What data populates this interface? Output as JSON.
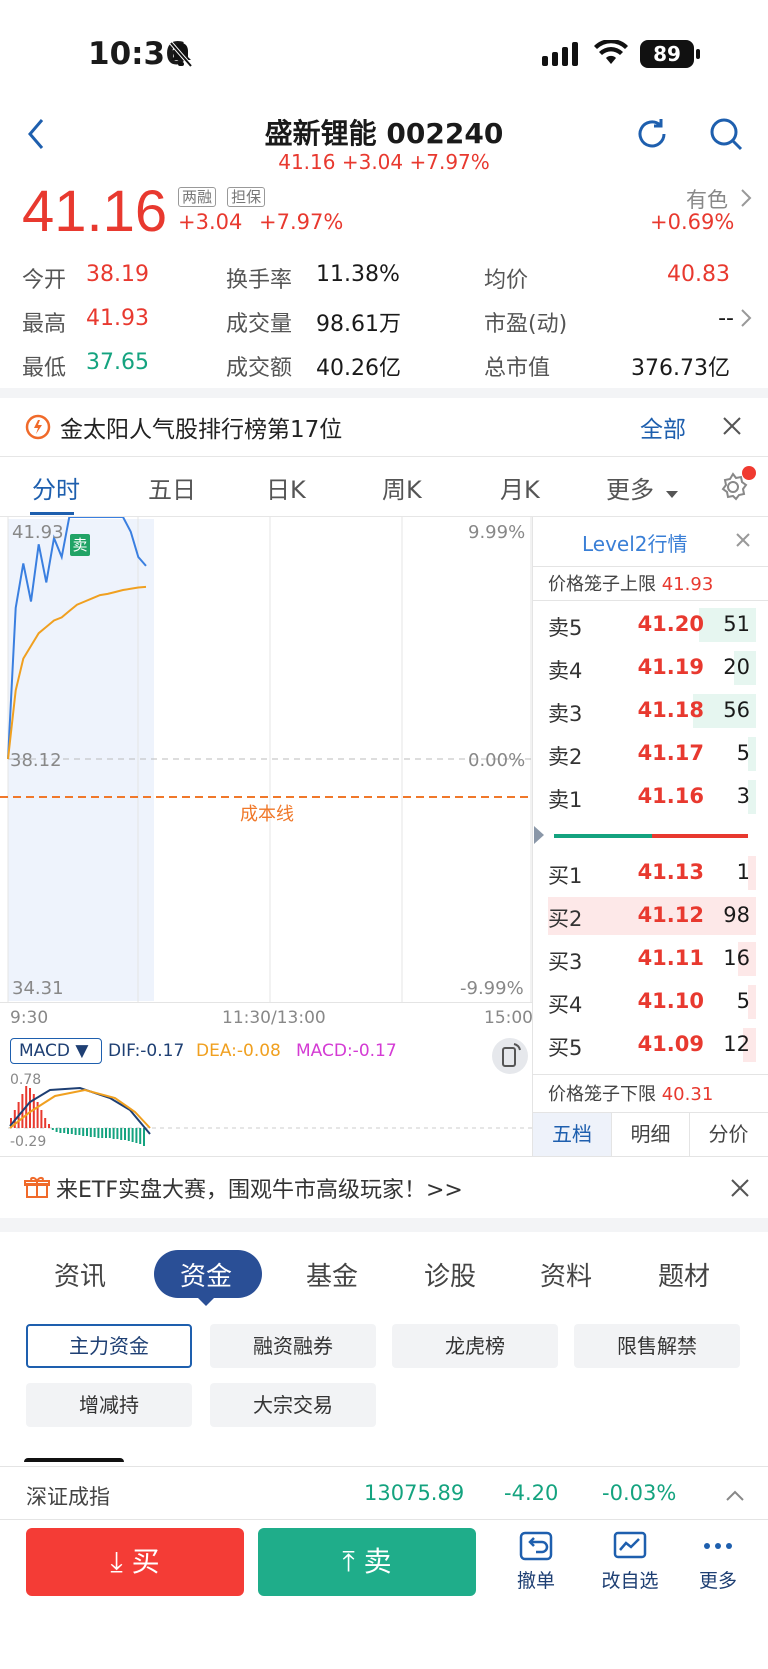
{
  "status": {
    "time": "10:36",
    "battery": "89"
  },
  "header": {
    "title": "盛新锂能 002240",
    "subtitle": "41.16 +3.04 +7.97%"
  },
  "quote": {
    "price": "41.16",
    "tag_margin": "两融",
    "tag_guarantee": "担保",
    "change": "+3.04",
    "change_pct": "+7.97%",
    "sector_name": "有色",
    "sector_change": "+0.69%"
  },
  "stats": [
    {
      "label": "今开",
      "value": "38.19",
      "color": "red"
    },
    {
      "label": "换手率",
      "value": "11.38%",
      "color": "dark"
    },
    {
      "label": "均价",
      "value": "40.83",
      "color": "red"
    },
    {
      "label": "最高",
      "value": "41.93",
      "color": "red"
    },
    {
      "label": "成交量",
      "value": "98.61万",
      "color": "dark"
    },
    {
      "label": "市盈(动)",
      "value": "--",
      "color": "dark"
    },
    {
      "label": "最低",
      "value": "37.65",
      "color": "green"
    },
    {
      "label": "成交额",
      "value": "40.26亿",
      "color": "dark"
    },
    {
      "label": "总市值",
      "value": "376.73亿",
      "color": "dark"
    }
  ],
  "ranking_banner": {
    "text": "金太阳人气股排行榜第17位",
    "action": "全部"
  },
  "chart_tabs": [
    "分时",
    "五日",
    "日K",
    "周K",
    "月K",
    "更多"
  ],
  "chart_labels": {
    "high": "41.93",
    "open": "38.12",
    "low": "34.31",
    "pct_high": "9.99%",
    "pct_mid": "0.00%",
    "pct_low": "-9.99%",
    "cost_line": "成本线",
    "sell_marker": "卖",
    "time_start": "9:30",
    "time_mid": "11:30/13:00",
    "time_end": "15:00"
  },
  "chart_data": {
    "type": "line",
    "x_range": [
      "9:30",
      "15:00"
    ],
    "ylim": [
      34.31,
      41.93
    ],
    "series": [
      {
        "values": [
          38.12,
          40.5,
          41.2,
          40.6,
          41.5,
          40.9,
          41.6,
          41.3,
          41.93,
          41.93,
          41.93,
          41.93,
          41.93,
          41.93,
          41.93,
          41.93,
          41.7,
          41.3,
          41.16
        ]
      },
      {
        "values": [
          38.12,
          39.2,
          39.7,
          39.9,
          40.1,
          40.2,
          40.3,
          40.35,
          40.45,
          40.55,
          40.6,
          40.65,
          40.7,
          40.72,
          40.75,
          40.78,
          40.8,
          40.82,
          40.83
        ]
      }
    ]
  },
  "macd": {
    "selector": "MACD",
    "dif": "DIF:-0.17",
    "dea": "DEA:-0.08",
    "macd": "MACD:-0.17",
    "top": "0.78",
    "bottom": "-0.29"
  },
  "orderbook": {
    "title": "Level2行情",
    "upper_limit_label": "价格笼子上限",
    "upper_limit": "41.93",
    "lower_limit_label": "价格笼子下限",
    "lower_limit": "40.31",
    "sells": [
      {
        "label": "卖5",
        "price": "41.20",
        "vol": "51",
        "fill": 0.52
      },
      {
        "label": "卖4",
        "price": "41.19",
        "vol": "20",
        "fill": 0.2
      },
      {
        "label": "卖3",
        "price": "41.18",
        "vol": "56",
        "fill": 0.57
      },
      {
        "label": "卖2",
        "price": "41.17",
        "vol": "5",
        "fill": 0.05
      },
      {
        "label": "卖1",
        "price": "41.16",
        "vol": "3",
        "fill": 0.03
      }
    ],
    "buys": [
      {
        "label": "买1",
        "price": "41.13",
        "vol": "1",
        "fill": 0.01
      },
      {
        "label": "买2",
        "price": "41.12",
        "vol": "98",
        "fill": 1.0
      },
      {
        "label": "买3",
        "price": "41.11",
        "vol": "16",
        "fill": 0.16
      },
      {
        "label": "买4",
        "price": "41.10",
        "vol": "5",
        "fill": 0.05
      },
      {
        "label": "买5",
        "price": "41.09",
        "vol": "12",
        "fill": 0.12
      }
    ],
    "tabs": [
      "五档",
      "明细",
      "分价"
    ]
  },
  "etf_banner": {
    "text": "来ETF实盘大赛，围观牛市高级玩家！>>"
  },
  "section_tabs": [
    "资讯",
    "资金",
    "基金",
    "诊股",
    "资料",
    "题材"
  ],
  "fund_chips": [
    "主力资金",
    "融资融券",
    "龙虎榜",
    "限售解禁",
    "增减持",
    "大宗交易"
  ],
  "index_bar": {
    "name": "深证成指",
    "value": "13075.89",
    "change": "-4.20",
    "pct": "-0.03%"
  },
  "bottom_bar": {
    "buy": "买",
    "sell": "卖",
    "cancel": "撤单",
    "edit_watch": "改自选",
    "more": "更多"
  }
}
